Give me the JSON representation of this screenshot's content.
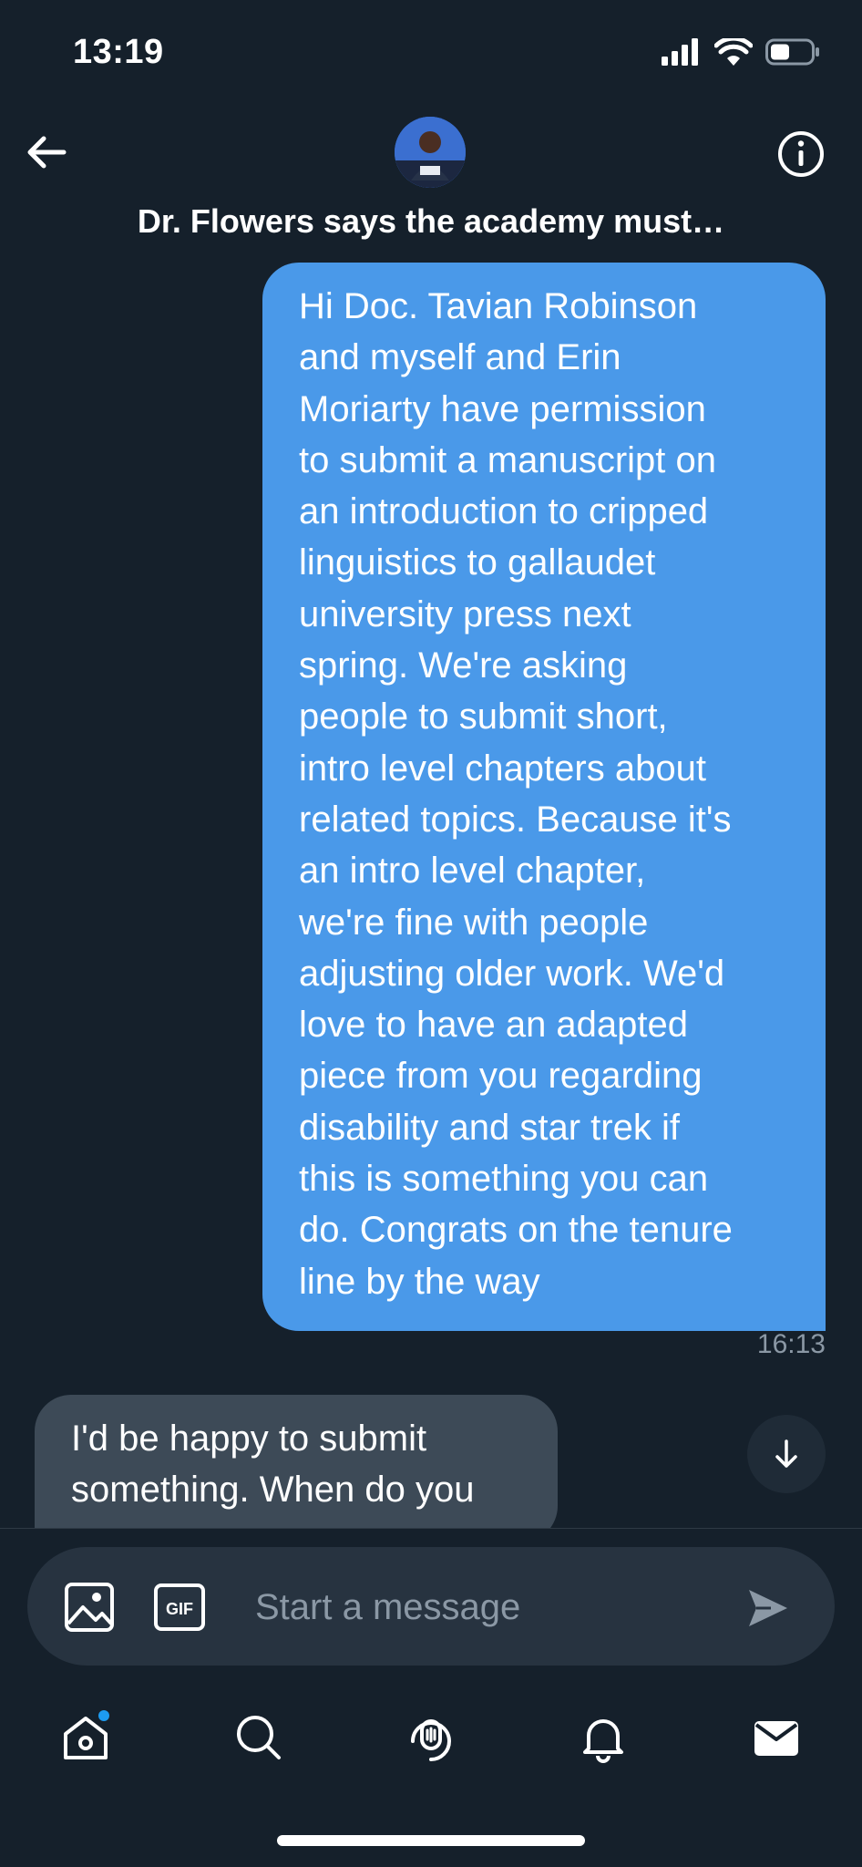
{
  "status": {
    "time": "13:19"
  },
  "header": {
    "title": "Dr. Flowers says the academy must…"
  },
  "messages": {
    "sent": {
      "lines": [
        "Hi Doc. Tavian Robinson",
        "and myself and Erin",
        "Moriarty have permission",
        "to submit a manuscript on",
        "an introduction to cripped",
        "linguistics to gallaudet",
        "university press next",
        "spring. We're asking",
        "people to submit short,",
        "intro level chapters about",
        "related topics. Because it's",
        "an intro level chapter,",
        "we're fine with people",
        "adjusting older work. We'd",
        "love to have an adapted",
        "piece from you regarding",
        "disability and star trek if",
        "this is something you can",
        "do. Congrats on the tenure",
        "line by the way"
      ],
      "time": "16:13"
    },
    "received": {
      "lines": [
        "I'd be happy to submit",
        "something. When do you"
      ]
    }
  },
  "composer": {
    "placeholder": "Start a message",
    "gif_label": "GIF"
  },
  "icons": {
    "back": "arrow-left-icon",
    "info": "info-icon",
    "media": "image-icon",
    "gif": "gif-icon",
    "send": "send-icon",
    "scroll": "arrow-down-icon",
    "tabs": [
      "home-icon",
      "search-icon",
      "spaces-icon",
      "notifications-icon",
      "messages-icon"
    ]
  },
  "colors": {
    "background": "#15202b",
    "sent_bubble": "#4a99e9",
    "received_bubble": "#3d4a57",
    "accent": "#1d9bf0",
    "muted_text": "#8b98a5"
  }
}
